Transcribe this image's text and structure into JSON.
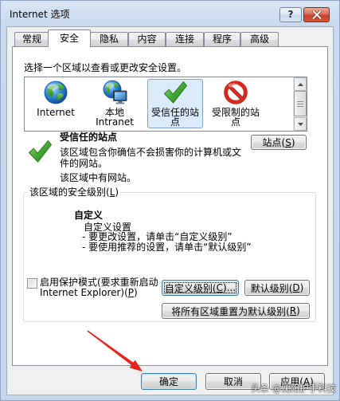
{
  "window": {
    "title": "Internet 选项",
    "help_label": "?",
    "close_icon": "close-icon"
  },
  "tabs": [
    {
      "label": "常规",
      "selected": false
    },
    {
      "label": "安全",
      "selected": true
    },
    {
      "label": "隐私",
      "selected": false
    },
    {
      "label": "内容",
      "selected": false
    },
    {
      "label": "连接",
      "selected": false
    },
    {
      "label": "程序",
      "selected": false
    },
    {
      "label": "高级",
      "selected": false
    }
  ],
  "security": {
    "zone_prompt": "选择一个区域以查看或更改安全设置。",
    "zones": [
      {
        "label": "Internet",
        "icon": "globe-icon",
        "selected": false
      },
      {
        "label": "本地 Intranet",
        "icon": "intranet-icon",
        "selected": false
      },
      {
        "label": "受信任的站点",
        "icon": "green-check-icon",
        "selected": true
      },
      {
        "label": "受限制的站点",
        "icon": "no-entry-icon",
        "selected": false
      }
    ],
    "selected_zone": {
      "icon": "green-check-icon",
      "title": "受信任的站点",
      "description": "该区域包含你确信不会损害你的计算机或文件的网站。",
      "site_status": "该区域中有网站。",
      "sites_button": {
        "pre": "站点(",
        "key": "S",
        "post": ")"
      }
    },
    "level_group": {
      "label": {
        "pre": "该区域的安全级别(",
        "key": "L",
        "post": ")"
      },
      "level_name": "自定义",
      "lines": [
        "自定义设置",
        "- 要更改设置，请单击“自定义级别”",
        "- 要使用推荐的设置，请单击“默认级别”"
      ],
      "protected_mode": {
        "pre": "启用保护模式(要求重新启动 Internet Explorer)(",
        "key": "P",
        "post": ")",
        "checked": false
      },
      "custom_level_button": {
        "pre": "自定义级别(",
        "key": "C",
        "post": ")..."
      },
      "default_level_button": {
        "pre": "默认级别(",
        "key": "D",
        "post": ")"
      },
      "reset_all_button": {
        "pre": "将所有区域重置为默认级别(",
        "key": "R",
        "post": ")"
      }
    }
  },
  "footer": {
    "ok_label": "确定",
    "cancel_label": "取消",
    "apply_button": {
      "pre": "应用(",
      "key": "A",
      "post": ")"
    }
  },
  "watermark": "头条 @沈阳护手科技",
  "colors": {
    "dialog_background": "#f0f0f0",
    "selection_fill": "#dcebfc",
    "selection_border": "#7da2ce",
    "close_button": "#c7402b",
    "focus_border": "#3c7fb1",
    "annotation_arrow": "#e8231c"
  }
}
